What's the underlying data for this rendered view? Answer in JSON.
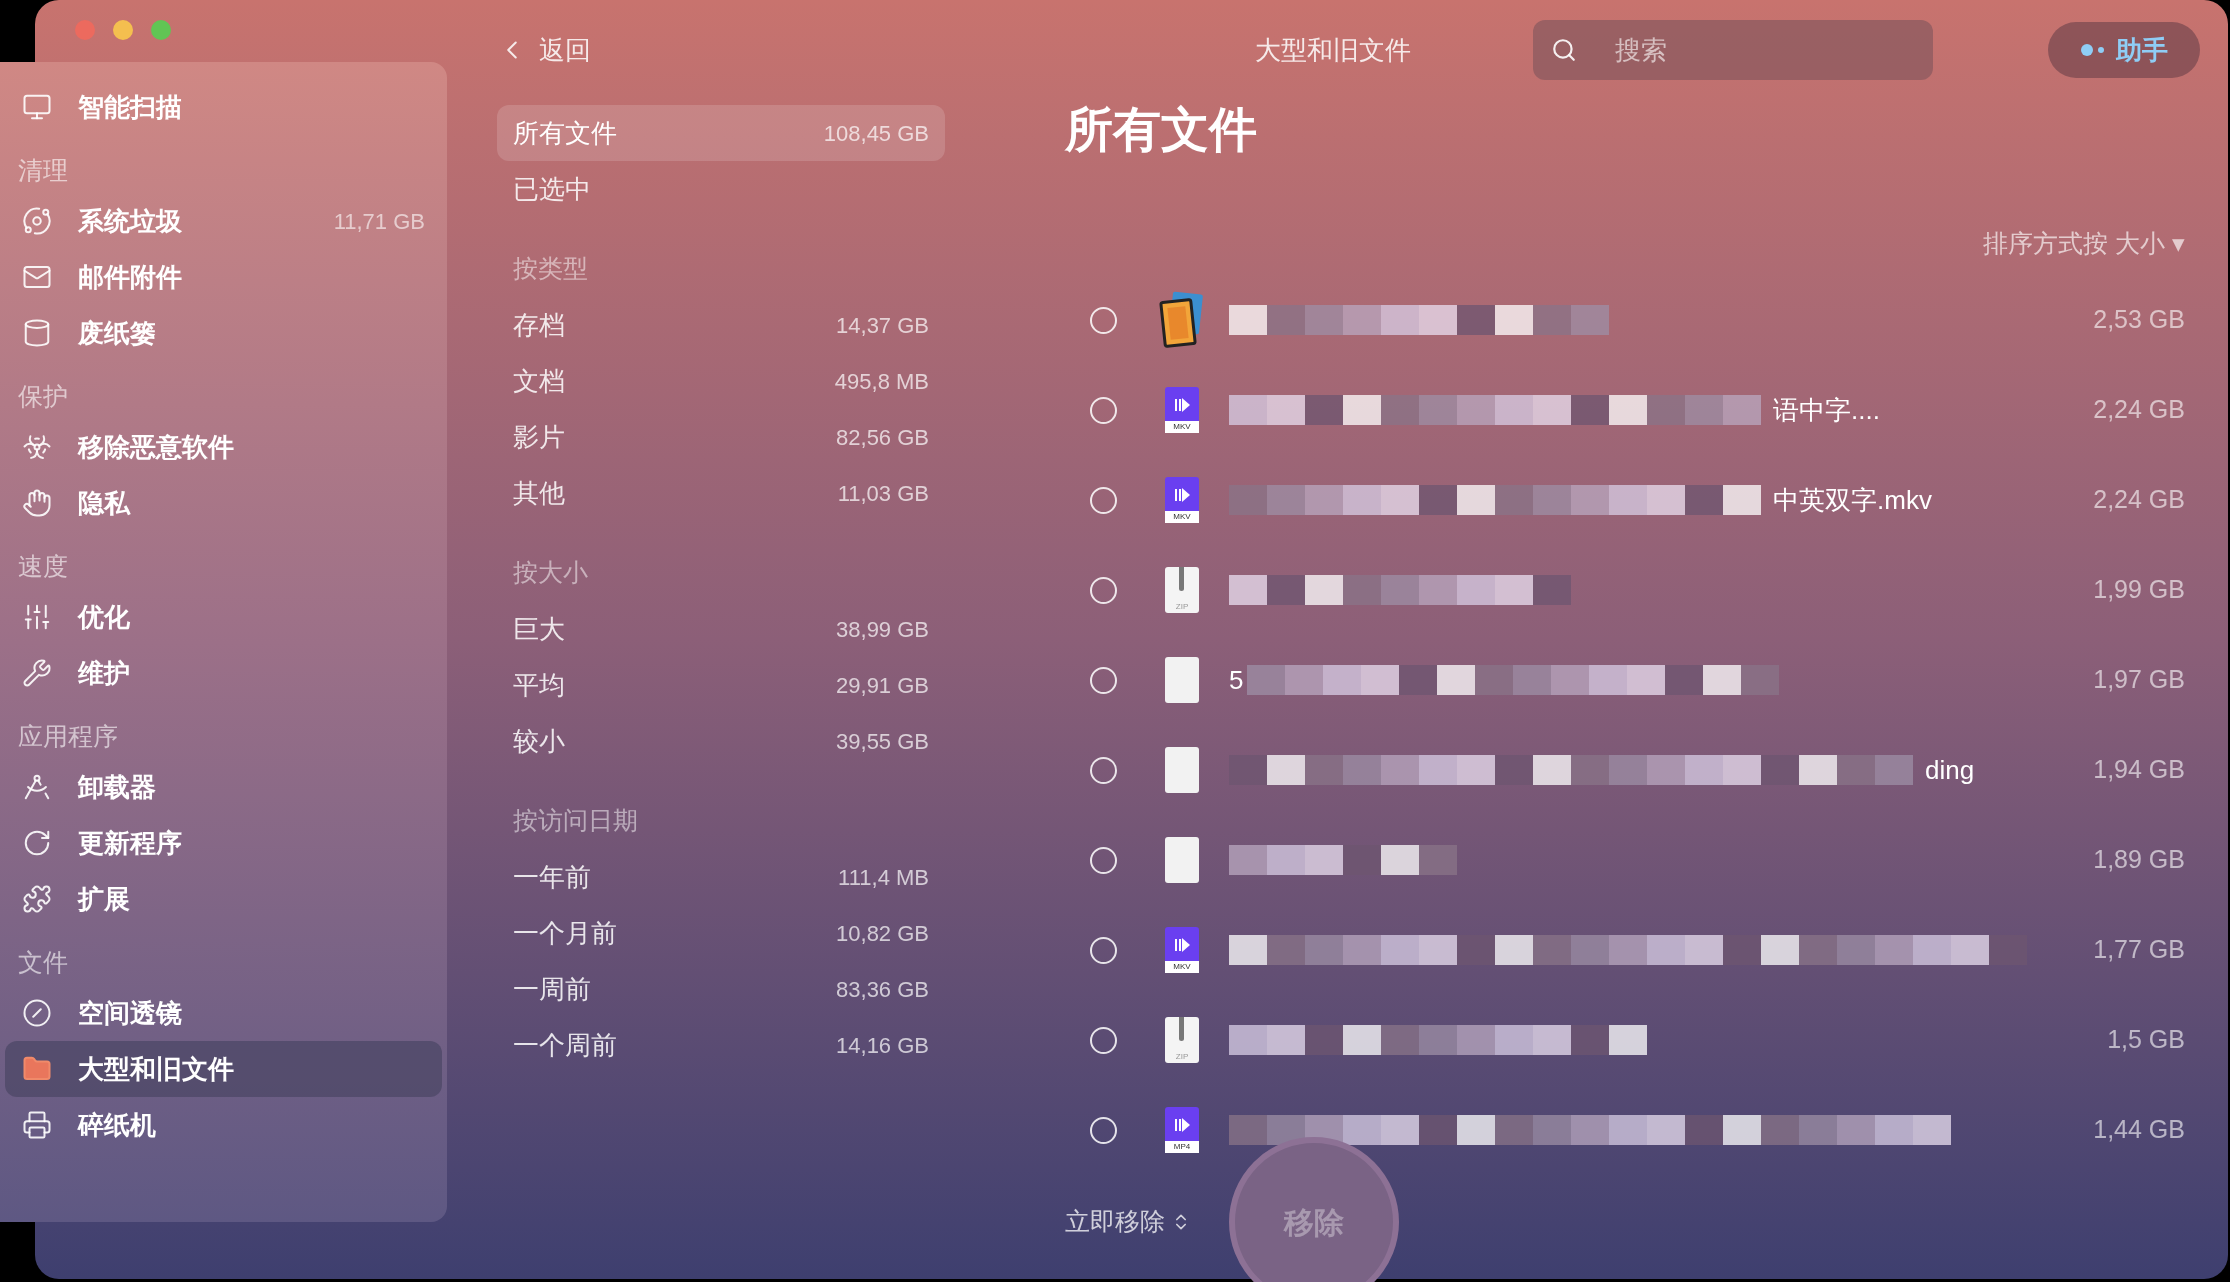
{
  "sidebar": {
    "top_items": [
      {
        "label": "智能扫描",
        "selected": false
      }
    ],
    "sections": [
      {
        "title": "清理",
        "items": [
          {
            "label": "系统垃圾",
            "size": "11,71 GB",
            "selected": false
          },
          {
            "label": "邮件附件",
            "selected": false
          },
          {
            "label": "废纸篓",
            "selected": false
          }
        ]
      },
      {
        "title": "保护",
        "items": [
          {
            "label": "移除恶意软件",
            "selected": false
          },
          {
            "label": "隐私",
            "selected": false
          }
        ]
      },
      {
        "title": "速度",
        "items": [
          {
            "label": "优化",
            "selected": false
          },
          {
            "label": "维护",
            "selected": false
          }
        ]
      },
      {
        "title": "应用程序",
        "items": [
          {
            "label": "卸载器",
            "selected": false
          },
          {
            "label": "更新程序",
            "selected": false
          },
          {
            "label": "扩展",
            "selected": false
          }
        ]
      },
      {
        "title": "文件",
        "items": [
          {
            "label": "空间透镜",
            "selected": false
          },
          {
            "label": "大型和旧文件",
            "selected": true
          },
          {
            "label": "碎纸机",
            "selected": false
          }
        ]
      }
    ]
  },
  "back": "返回",
  "filters": {
    "top_items": [
      {
        "label": "所有文件",
        "size": "108,45 GB",
        "selected": true
      },
      {
        "label": "已选中",
        "selected": false
      }
    ],
    "groups": [
      {
        "title": "按类型",
        "items": [
          {
            "label": "存档",
            "size": "14,37 GB",
            "selected": false
          },
          {
            "label": "文档",
            "size": "495,8 MB",
            "selected": false
          },
          {
            "label": "影片",
            "size": "82,56 GB",
            "selected": false
          },
          {
            "label": "其他",
            "size": "11,03 GB",
            "selected": false
          }
        ]
      },
      {
        "title": "按大小",
        "items": [
          {
            "label": "巨大",
            "size": "38,99 GB",
            "selected": false
          },
          {
            "label": "平均",
            "size": "29,91 GB",
            "selected": false
          },
          {
            "label": "较小",
            "size": "39,55 GB",
            "selected": false
          }
        ]
      },
      {
        "title": "按访问日期",
        "items": [
          {
            "label": "一年前",
            "size": "111,4 MB",
            "selected": false
          },
          {
            "label": "一个月前",
            "size": "10,82 GB",
            "selected": false
          },
          {
            "label": "一周前",
            "size": "83,36 GB",
            "selected": false
          },
          {
            "label": "一个周前",
            "size": "14,16 GB",
            "selected": false
          }
        ]
      }
    ]
  },
  "header": {
    "title": "大型和旧文件",
    "search": {
      "placeholder": "搜索"
    },
    "assistant": "助手"
  },
  "content": {
    "title": "所有文件",
    "sort": "排序方式按 大小 ▾",
    "files": [
      {
        "kind": "movie",
        "size": "2,53 GB",
        "checked": false
      },
      {
        "kind": "document",
        "icon_label": "MKV",
        "name_tail": "语中字....",
        "size": "2,24 GB",
        "checked": false
      },
      {
        "kind": "document",
        "icon_label": "MKV",
        "name_tail": "中英双字.mkv",
        "size": "2,24 GB",
        "checked": false
      },
      {
        "kind": "archive",
        "icon_label": "ZIP",
        "size": "1,99 GB",
        "checked": false
      },
      {
        "kind": "blank",
        "name_head": "5",
        "size": "1,97 GB",
        "checked": false
      },
      {
        "kind": "blank",
        "name_tail": "ding",
        "size": "1,94 GB",
        "checked": false
      },
      {
        "kind": "blank",
        "size": "1,89 GB",
        "checked": false
      },
      {
        "kind": "document",
        "icon_label": "MKV",
        "size": "1,77 GB",
        "checked": false
      },
      {
        "kind": "archive",
        "icon_label": "ZIP",
        "size": "1,5 GB",
        "checked": false
      },
      {
        "kind": "document",
        "icon_label": "MP4",
        "size": "1,44 GB",
        "checked": false
      }
    ],
    "action_menu": "立即移除",
    "remove_button": "移除"
  }
}
